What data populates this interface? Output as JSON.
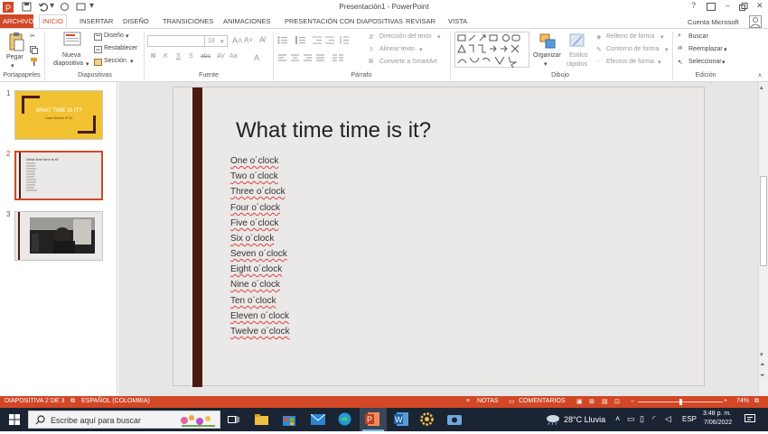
{
  "window": {
    "title": "Presentación1 - PowerPoint",
    "help": "?",
    "account": "Cuenta Microsoft"
  },
  "tabs": [
    "ARCHIVO",
    "INICIO",
    "INSERTAR",
    "DISEÑO",
    "TRANSICIONES",
    "ANIMACIONES",
    "PRESENTACIÓN CON DIAPOSITIVAS",
    "REVISAR",
    "VISTA"
  ],
  "ribbon": {
    "paste": "Pegar",
    "new_slide_1": "Nueva",
    "new_slide_2": "diapositiva",
    "design": "Diseño",
    "reset": "Restablecer",
    "section": "Sección",
    "font_size": "18",
    "text_direction": "Dirección del texto",
    "align_text": "Alinear texto",
    "smartart": "Convertir a SmartArt",
    "arrange": "Organizar",
    "quick_styles_1": "Estilos",
    "quick_styles_2": "rápidos",
    "shape_fill": "Relleno de forma",
    "shape_outline": "Contorno de forma",
    "shape_effects": "Efectos de forma",
    "find": "Buscar",
    "replace": "Reemplazar",
    "select": "Seleccionar",
    "groups": {
      "clipboard": "Portapapeles",
      "slides": "Diapositivas",
      "font": "Fuente",
      "paragraph": "Párrafo",
      "drawing": "Dibujo",
      "editing": "Edición"
    }
  },
  "thumbnails": [
    {
      "num": "1",
      "title": "WHAT TIME IS IT?",
      "subtitle": "Juan Nunez 8°10"
    },
    {
      "num": "2",
      "title": "What time time is it?"
    },
    {
      "num": "3"
    }
  ],
  "slide": {
    "title": "What time time is it?",
    "items": [
      "One o´clock",
      "Two o´clock",
      "Three o´clock",
      "Four o´clock",
      "Five o´clock",
      "Six o´clock",
      "Seven o´clock",
      "Eight o´clock",
      "Nine o´clock",
      "Ten o´clock",
      "Eleven o´clock",
      "Twelve o´clock"
    ]
  },
  "status": {
    "slide_info": "DIAPOSITIVA 2 DE 3",
    "language": "ESPAÑOL (COLOMBIA)",
    "notes": "NOTAS",
    "comments": "COMENTARIOS",
    "zoom": "74%",
    "zoom_fraction": 0.5
  },
  "taskbar": {
    "search_placeholder": "Escribe aquí para buscar",
    "weather": "28°C  Lluvia",
    "lang": "ESP",
    "time": "3:48 p. m.",
    "date": "7/06/2022"
  },
  "colors": {
    "accent": "#d24726",
    "slide_bar": "#4a1c14",
    "thumb1_bg": "#f2c232",
    "taskbar": "#1a2433"
  }
}
